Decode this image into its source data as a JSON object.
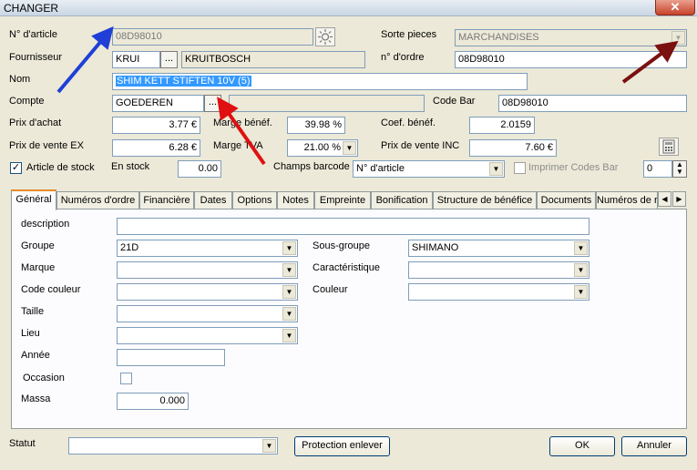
{
  "window": {
    "title": "CHANGER",
    "close_glyph": "✕"
  },
  "header": {
    "article_no_label": "N° d'article",
    "article_no_value": "08D98010",
    "sorte_label": "Sorte pieces",
    "sorte_value": "MARCHANDISES",
    "fournisseur_label": "Fournisseur",
    "fournisseur_code": "KRUI",
    "fournisseur_name": "KRUITBOSCH",
    "ordre_label": "n° d'ordre",
    "ordre_value": "08D98010",
    "nom_label": "Nom",
    "nom_value": "SHIM KETT STIFTEN 10V (5)",
    "compte_label": "Compte",
    "compte_value": "GOEDEREN",
    "codebar_label": "Code Bar",
    "codebar_value": "08D98010",
    "prix_achat_label": "Prix d'achat",
    "prix_achat_value": "3.77 €",
    "marge_benef_label": "Marge bénéf.",
    "marge_benef_value": "39.98 %",
    "coef_benef_label": "Coef. bénéf.",
    "coef_benef_value": "2.0159",
    "prix_vente_ex_label": "Prix de vente EX",
    "prix_vente_ex_value": "6.28 €",
    "marge_tva_label": "Marge TVA",
    "marge_tva_value": "21.00 %",
    "prix_vente_inc_label": "Prix de vente INC",
    "prix_vente_inc_value": "7.60 €",
    "article_stock_label": "Article de stock",
    "article_stock_checked": "✓",
    "en_stock_label": "En stock",
    "en_stock_value": "0.00",
    "champs_barcode_label": "Champs barcode",
    "champs_barcode_value": "N° d'article",
    "imprimer_label": "Imprimer Codes Bar",
    "imprimer_qty": "0",
    "ellipsis": "..."
  },
  "tabs": [
    {
      "label": "Général"
    },
    {
      "label": "Numéros d'ordre"
    },
    {
      "label": "Financière"
    },
    {
      "label": "Dates"
    },
    {
      "label": "Options"
    },
    {
      "label": "Notes"
    },
    {
      "label": "Empreinte"
    },
    {
      "label": "Bonification"
    },
    {
      "label": "Structure de bénéfice"
    },
    {
      "label": "Documents"
    },
    {
      "label": "Numéros de r"
    }
  ],
  "general": {
    "description_label": "description",
    "description_value": "",
    "groupe_label": "Groupe",
    "groupe_value": "21D",
    "sous_groupe_label": "Sous-groupe",
    "sous_groupe_value": "SHIMANO",
    "marque_label": "Marque",
    "marque_value": "",
    "caracteristique_label": "Caractéristique",
    "caracteristique_value": "",
    "code_couleur_label": "Code couleur",
    "code_couleur_value": "",
    "couleur_label": "Couleur",
    "couleur_value": "",
    "taille_label": "Taille",
    "taille_value": "",
    "lieu_label": "Lieu",
    "lieu_value": "",
    "annee_label": "Année",
    "annee_value": "",
    "occasion_label": "Occasion",
    "massa_label": "Massa",
    "massa_value": "0.000"
  },
  "footer": {
    "statut_label": "Statut",
    "statut_value": "",
    "protection_label": "Protection enlever",
    "ok_label": "OK",
    "annuler_label": "Annuler"
  },
  "colors": {
    "arrow_blue": "#1f3fd6",
    "arrow_red": "#e01010",
    "arrow_darkred": "#7a1010"
  }
}
